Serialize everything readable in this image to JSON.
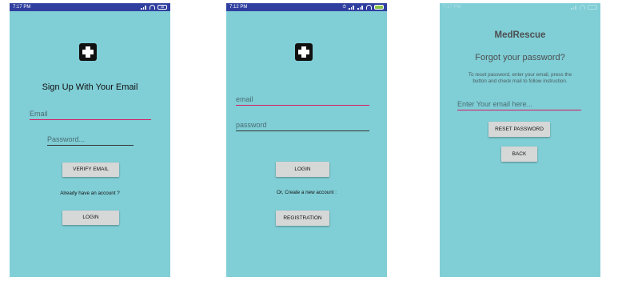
{
  "screen_signup": {
    "status_time": "7:17 PM",
    "battery": "48",
    "heading": "Sign Up With Your Email",
    "email_placeholder": "Email",
    "password_placeholder": "Password...",
    "verify_button": "VERIFY EMAIL",
    "account_prompt": "Already  have an account ?",
    "login_button": "LOGIN"
  },
  "screen_login": {
    "status_time": "7:12 PM",
    "email_placeholder": "email",
    "password_placeholder": "password",
    "login_button": "LOGIN",
    "create_prompt": "Or, Create a new account :",
    "registration_button": "REGISTRATION"
  },
  "screen_reset": {
    "status_time": "7:17 PM",
    "app_name": "MedRescue",
    "heading": "Forgot your password?",
    "instruction_line1": "To reset password, enter your email, press the",
    "instruction_line2": "button and check mail to follow instruction.",
    "email_placeholder": "Enter Your email here...",
    "reset_button": "RESET PASSWORD",
    "back_button": "BACK"
  },
  "colors": {
    "background": "#80ced6",
    "status_bar": "#303f9f",
    "accent": "#d81b60",
    "button": "#d6d7d7"
  }
}
